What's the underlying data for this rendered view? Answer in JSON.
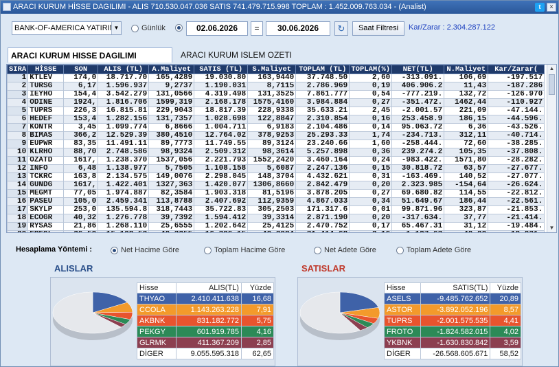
{
  "window": {
    "title": "ARACI KURUM HİSSE DAGILIMI - ALIS 710.530.047.036  SATIS 741.479.715.998  TOPLAM : 1.452.009.763.034 - (Analist)",
    "twitter_label": "t",
    "close_label": "×"
  },
  "toolbar": {
    "broker": "BANK-OF-AMERICA YATIRIM",
    "radio_gunluk": "Günlük",
    "date_from": "02.06.2026",
    "equals": "=",
    "date_to": "30.06.2026",
    "refresh_icon": "↻",
    "saat_filtresi": "Saat Filtresi",
    "kar_zarar": "Kar/Zarar : 2.304.287.122"
  },
  "tabs": [
    "ARACI KURUM HISSE DAGILIMI",
    "ARACI KURUM ISLEM OZETI"
  ],
  "grid": {
    "columns": [
      "SIRA",
      "HİSSE",
      "SON",
      "ALIS (TL)",
      "A.Maliyet",
      "SATIS (TL)",
      "S.Maliyet",
      "TOPLAM (TL)",
      "TOPLAM(%)",
      "NET(TL)",
      "N.Maliyet",
      "Kar/Zarar("
    ],
    "rows": [
      [
        "1",
        "KTLEV",
        "174,0",
        "18.717.70",
        "165,4289",
        "19.030.80",
        "163,9440",
        "37.748.50",
        "2,60",
        "-313.091.",
        "106,69",
        "-197.517"
      ],
      [
        "2",
        "TURSG",
        "6,17",
        "1.596.937",
        "9,2737",
        "1.190.031",
        "8,7115",
        "2.786.969",
        "0,19",
        "406.906.2",
        "11,43",
        "-187.286"
      ],
      [
        "3",
        "IEYHO",
        "154,4",
        "3.542.279",
        "131,0566",
        "4.319.498",
        "131,3525",
        "7.861.777",
        "0,54",
        "-777.219.",
        "132,72",
        "-126.970"
      ],
      [
        "4",
        "ODINE",
        "1924,",
        "1.816.706",
        "1599,319",
        "2.168.178",
        "1575,4160",
        "3.984.884",
        "0,27",
        "-351.472.",
        "1462,44",
        "-110.927"
      ],
      [
        "5",
        "TUPRS",
        "226,3",
        "16.815.81",
        "229,9043",
        "18.817.39",
        "228,9338",
        "35.633.21",
        "2,45",
        "-2.001.57",
        "221,09",
        "-47.144."
      ],
      [
        "6",
        "HEDEF",
        "153,4",
        "1.282.156",
        "131,7357",
        "1.028.698",
        "122,8847",
        "2.310.854",
        "0,16",
        "253.458.9",
        "186,15",
        "-44.596."
      ],
      [
        "7",
        "KONTR",
        "3,45",
        "1.099.774",
        "6,8666",
        "1.004.711",
        "6,9183",
        "2.104.486",
        "0,14",
        "95.063.72",
        "6,36",
        "-43.526."
      ],
      [
        "8",
        "BIMAS",
        "366,2",
        "12.529.39",
        "380,4510",
        "12.764.02",
        "378,9253",
        "25.293.33",
        "1,74",
        "-234.713.",
        "312,11",
        "-40.714."
      ],
      [
        "9",
        "EUPWR",
        "83,35",
        "11.491.11",
        "89,7773",
        "11.749.55",
        "89,3124",
        "23.240.66",
        "1,60",
        "-258.444.",
        "72,60",
        "-38.285."
      ],
      [
        "10",
        "KLRHO",
        "88,70",
        "2.748.586",
        "98,9324",
        "2.509.312",
        "98,3614",
        "5.257.898",
        "0,36",
        "239.274.2",
        "105,35",
        "-37.808."
      ],
      [
        "11",
        "OZATD",
        "1617,",
        "1.238.370",
        "1537,056",
        "2.221.793",
        "1552,2420",
        "3.460.164",
        "0,24",
        "-983.422.",
        "1571,80",
        "-28.282."
      ],
      [
        "12",
        "INFO",
        "6,48",
        "1.138.977",
        "5,7505",
        "1.108.158",
        "5,6087",
        "2.247.136",
        "0,15",
        "30.818.72",
        "63,57",
        "-27.677."
      ],
      [
        "13",
        "TCKRC",
        "163,8",
        "2.134.575",
        "149,0076",
        "2.298.045",
        "148,3704",
        "4.432.621",
        "0,31",
        "-163.469.",
        "140,52",
        "-27.077."
      ],
      [
        "14",
        "GUNDG",
        "1617,",
        "1.422.401",
        "1327,363",
        "1.420.077",
        "1306,8660",
        "2.842.479",
        "0,20",
        "2.323.985",
        "-154,64",
        "-26.624."
      ],
      [
        "15",
        "MEGMT",
        "77,05",
        "1.974.887",
        "82,3584",
        "1.903.318",
        "81,5196",
        "3.878.205",
        "0,27",
        "69.680.82",
        "114,55",
        "-22.812."
      ],
      [
        "16",
        "PASEU",
        "105,0",
        "2.459.341",
        "113,8788",
        "2.407.692",
        "112,9359",
        "4.867.033",
        "0,34",
        "51.649.67",
        "186,44",
        "-22.561."
      ],
      [
        "17",
        "SKYLP",
        "253,0",
        "135.594.8",
        "318,7443",
        "35.722.83",
        "305,2503",
        "171.317.6",
        "0,01",
        "99.871.96",
        "323,87",
        "-21.853."
      ],
      [
        "18",
        "ECOGR",
        "40,32",
        "1.276.778",
        "39,7392",
        "1.594.412",
        "39,3314",
        "2.871.190",
        "0,20",
        "-317.634.",
        "37,77",
        "-21.414."
      ],
      [
        "19",
        "RYSAS",
        "21,86",
        "1.268.110",
        "25,6555",
        "1.202.642",
        "25,4125",
        "2.470.752",
        "0,17",
        "65.467.31",
        "31,12",
        "-19.484."
      ],
      [
        "20",
        "EREGL",
        "26,50",
        "15.108.52",
        "40,3255",
        "16.306.15",
        "40,2084",
        "31.414.68",
        "2,16",
        "-1.197.63",
        "40,00",
        "-19.031."
      ]
    ]
  },
  "method": {
    "label": "Hesaplama Yöntemi :",
    "options": [
      "Net Hacime Göre",
      "Toplam Hacime Göre",
      "Net Adete Göre",
      "Toplam Adete Göre"
    ]
  },
  "alislar": {
    "title": "ALISLAR",
    "header": [
      "Hisse",
      "ALIS(TL)",
      "Yüzde"
    ],
    "rows": [
      {
        "name": "THYAO",
        "value": "2.410.411.638",
        "pct": "16,68",
        "color": "#3f62a8",
        "frac": 16.68
      },
      {
        "name": "CCOLA",
        "value": "1.143.263.228",
        "pct": "7,91",
        "color": "#f39a2b",
        "frac": 7.91
      },
      {
        "name": "AKBNK",
        "value": "831.182.772",
        "pct": "5,75",
        "color": "#e8542e",
        "frac": 5.75
      },
      {
        "name": "PEKGY",
        "value": "601.919.785",
        "pct": "4,16",
        "color": "#2c8a57",
        "frac": 4.16
      },
      {
        "name": "GLRMK",
        "value": "411.367.209",
        "pct": "2,85",
        "color": "#8c3f50",
        "frac": 2.85
      },
      {
        "name": "DİGER",
        "value": "9.055.595.318",
        "pct": "62,65",
        "color": "#e6e8ec",
        "frac": 62.65
      }
    ]
  },
  "satislar": {
    "title": "SATISLAR",
    "header": [
      "Hisse",
      "SATIS(TL)",
      "Yüzde"
    ],
    "rows": [
      {
        "name": "ASELS",
        "value": "-9.485.762.652",
        "pct": "20,89",
        "color": "#3f62a8",
        "frac": 20.89
      },
      {
        "name": "ASTOR",
        "value": "-3.892.052.196",
        "pct": "8,57",
        "color": "#f39a2b",
        "frac": 8.57
      },
      {
        "name": "TUPRS",
        "value": "-2.001.575.535",
        "pct": "4,41",
        "color": "#e8542e",
        "frac": 4.41
      },
      {
        "name": "FROTO",
        "value": "-1.824.582.015",
        "pct": "4,02",
        "color": "#2c8a57",
        "frac": 4.02
      },
      {
        "name": "YKBNK",
        "value": "-1.630.830.842",
        "pct": "3,59",
        "color": "#8c3f50",
        "frac": 3.59
      },
      {
        "name": "DİGER",
        "value": "-26.568.605.671",
        "pct": "58,52",
        "color": "#e6e8ec",
        "frac": 58.52
      }
    ]
  }
}
